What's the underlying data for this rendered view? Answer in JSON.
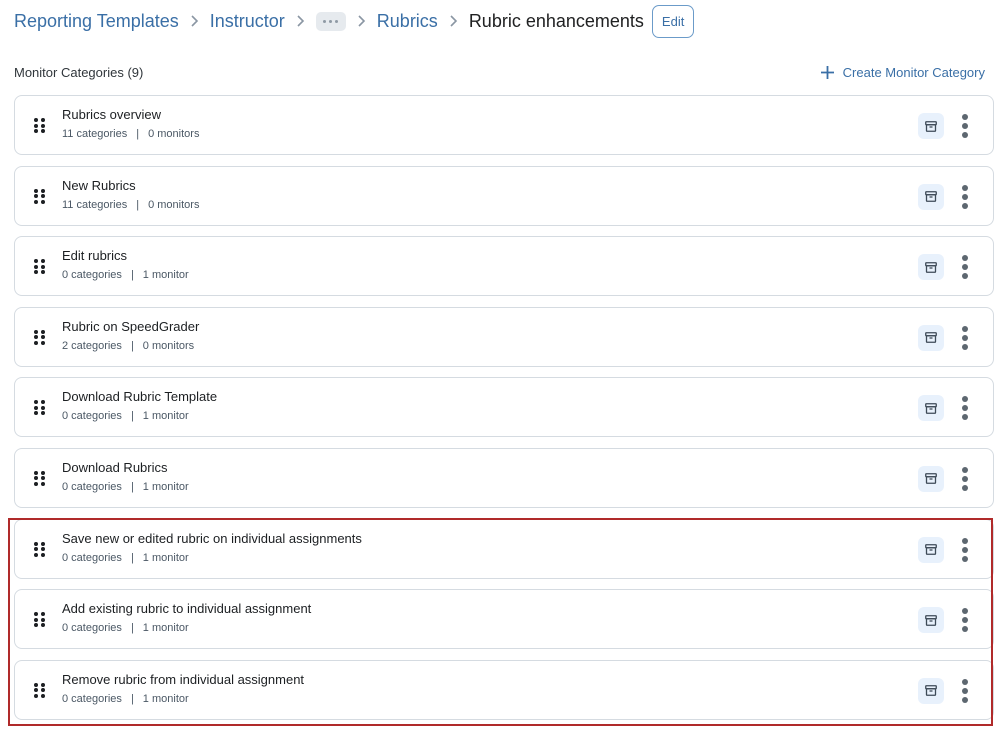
{
  "breadcrumb": {
    "items": [
      {
        "label": "Reporting Templates",
        "type": "link"
      },
      {
        "label": "Instructor",
        "type": "link"
      },
      {
        "label": "...",
        "type": "overflow"
      },
      {
        "label": "Rubrics",
        "type": "link"
      }
    ],
    "current": "Rubric enhancements",
    "edit_label": "Edit"
  },
  "section": {
    "title": "Monitor Categories (9)",
    "create_label": "Create Monitor Category",
    "create_icon": "plus-icon"
  },
  "rows": [
    {
      "title": "Rubrics overview",
      "categories": "11 categories",
      "monitors": "0 monitors",
      "highlighted": false
    },
    {
      "title": "New Rubrics",
      "categories": "11 categories",
      "monitors": "0 monitors",
      "highlighted": false
    },
    {
      "title": "Edit rubrics",
      "categories": "0 categories",
      "monitors": "1 monitor",
      "highlighted": false
    },
    {
      "title": "Rubric on SpeedGrader",
      "categories": "2 categories",
      "monitors": "0 monitors",
      "highlighted": false
    },
    {
      "title": "Download Rubric Template",
      "categories": "0 categories",
      "monitors": "1 monitor",
      "highlighted": false
    },
    {
      "title": "Download Rubrics",
      "categories": "0 categories",
      "monitors": "1 monitor",
      "highlighted": false
    },
    {
      "title": "Save new or edited rubric on individual assignments",
      "categories": "0 categories",
      "monitors": "1 monitor",
      "highlighted": true
    },
    {
      "title": "Add existing rubric to individual assignment",
      "categories": "0 categories",
      "monitors": "1 monitor",
      "highlighted": true
    },
    {
      "title": "Remove rubric from individual assignment",
      "categories": "0 categories",
      "monitors": "1 monitor",
      "highlighted": true
    }
  ],
  "row_separator": "|",
  "row_icons": {
    "drag": "drag-handle-icon",
    "archive": "archive-icon",
    "more": "more-vertical-icon"
  },
  "colors": {
    "link": "#3a6fa6",
    "highlight_border": "#b02a2a",
    "archive_bg": "#e8f1fc"
  }
}
